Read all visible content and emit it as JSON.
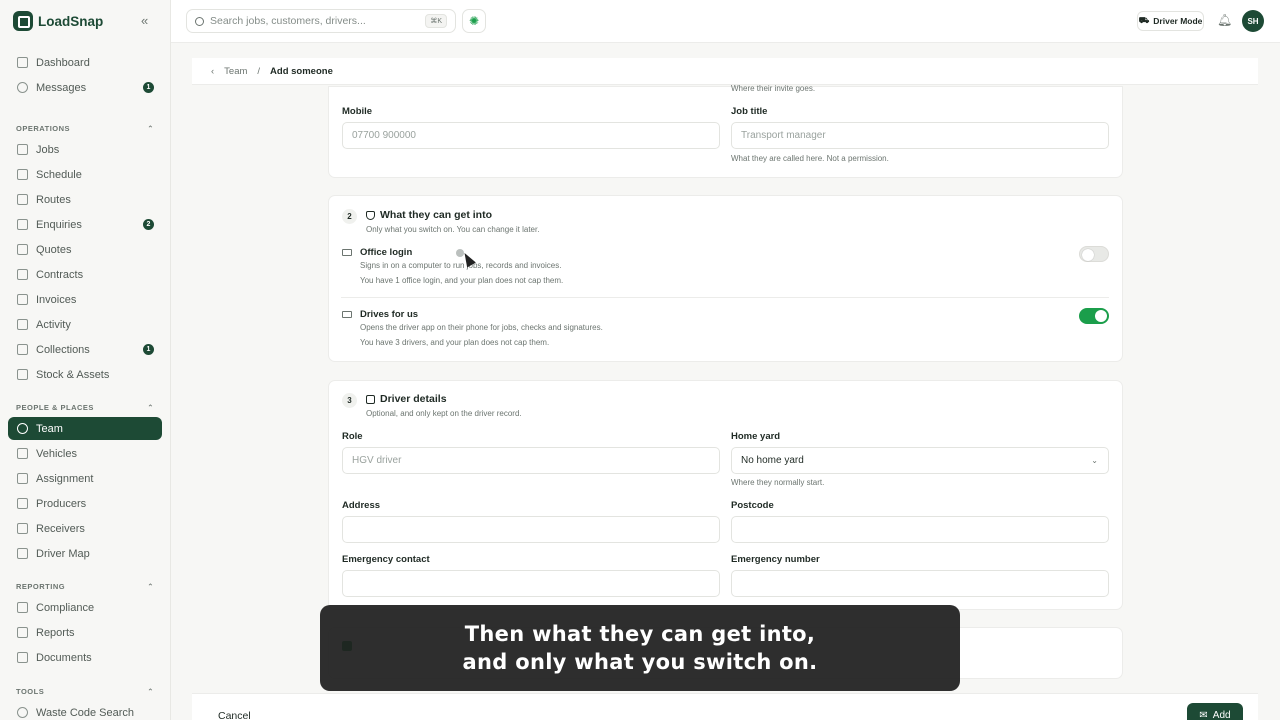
{
  "brand": {
    "name": "LoadSnap",
    "collapse_glyph": "«"
  },
  "nav": {
    "dashboard": "Dashboard",
    "messages": "Messages",
    "messages_badge": "1",
    "section_operations": "OPERATIONS",
    "jobs": "Jobs",
    "schedule": "Schedule",
    "routes": "Routes",
    "enquiries": "Enquiries",
    "enquiries_badge": "2",
    "quotes": "Quotes",
    "contracts": "Contracts",
    "invoices": "Invoices",
    "activity": "Activity",
    "collections": "Collections",
    "collections_badge": "1",
    "stock": "Stock & Assets",
    "section_people": "PEOPLE & PLACES",
    "team": "Team",
    "vehicles": "Vehicles",
    "assignment": "Assignment",
    "producers": "Producers",
    "receivers": "Receivers",
    "driver_map": "Driver Map",
    "section_reporting": "REPORTING",
    "compliance": "Compliance",
    "reports": "Reports",
    "documents": "Documents",
    "section_tools": "TOOLS",
    "waste_code": "Waste Code Search",
    "section_chevron": "⌃"
  },
  "topbar": {
    "search_placeholder": "Search jobs, customers, drivers...",
    "search_shortcut": "⌘K",
    "driver_mode": "Driver Mode",
    "avatar_initials": "SH"
  },
  "breadcrumb": {
    "back": "‹",
    "parent": "Team",
    "separator": "/",
    "current": "Add someone"
  },
  "step1": {
    "email_hint": "Where their invite goes.",
    "mobile_label": "Mobile",
    "mobile_placeholder": "07700 900000",
    "job_title_label": "Job title",
    "job_title_placeholder": "Transport manager",
    "job_title_hint": "What they are called here. Not a permission."
  },
  "step2": {
    "number": "2",
    "title": "What they can get into",
    "subtitle": "Only what you switch on. You can change it later.",
    "office_title": "Office login",
    "office_desc": "Signs in on a computer to run jobs, records and invoices.",
    "office_note": "You have 1 office login, and your plan does not cap them.",
    "office_enabled": false,
    "drives_title": "Drives for us",
    "drives_desc": "Opens the driver app on their phone for jobs, checks and signatures.",
    "drives_note": "You have 3 drivers, and your plan does not cap them.",
    "drives_enabled": true
  },
  "step3": {
    "number": "3",
    "title": "Driver details",
    "subtitle": "Optional, and only kept on the driver record.",
    "role_label": "Role",
    "role_placeholder": "HGV driver",
    "home_yard_label": "Home yard",
    "home_yard_value": "No home yard",
    "home_yard_hint": "Where they normally start.",
    "address_label": "Address",
    "postcode_label": "Postcode",
    "emergency_contact_label": "Emergency contact",
    "emergency_number_label": "Emergency number"
  },
  "footer": {
    "cancel": "Cancel",
    "add": "Add"
  },
  "caption": {
    "line1": "Then what they can get into,",
    "line2": "and only what you switch on."
  },
  "colors": {
    "brand": "#1d4a35",
    "accent": "#1b9e4b"
  }
}
